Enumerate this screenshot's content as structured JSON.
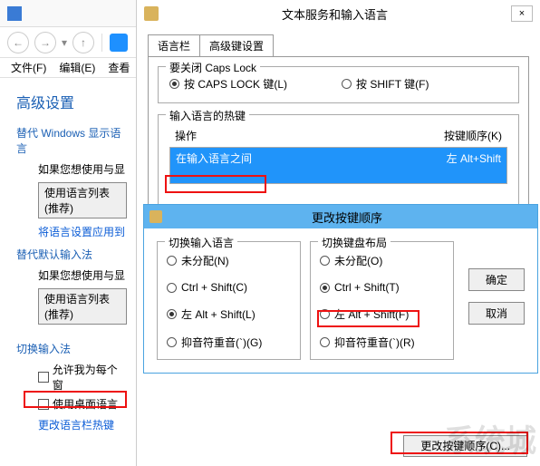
{
  "outer_window": {
    "title": "高级设置",
    "win_min": "—",
    "win_max": "□",
    "win_close": "×",
    "menu": {
      "file": "文件(F)",
      "edit": "编辑(E)",
      "view": "查看"
    }
  },
  "left": {
    "heading": "高级设置",
    "sec1": "替代 Windows 显示语言",
    "sec1_sub": "如果您想使用与显",
    "btn1": "使用语言列表(推荐)",
    "link1": "将语言设置应用到",
    "sec2": "替代默认输入法",
    "sec2_sub": "如果您想使用与显",
    "btn2": "使用语言列表(推荐)",
    "sec3": "切换输入法",
    "chk1": "允许我为每个窗",
    "chk2": "使用桌面语言",
    "link2": "更改语言栏热键"
  },
  "dlg1": {
    "title": "文本服务和输入语言",
    "close": "×",
    "tabs": {
      "t1": "语言栏",
      "t2": "高级键设置"
    },
    "caps_group": "要关闭 Caps Lock",
    "caps_r1": "按 CAPS LOCK 键(L)",
    "caps_r2": "按 SHIFT 键(F)",
    "hot_group": "输入语言的热键",
    "col_op": "操作",
    "col_key": "按键顺序(K)",
    "rows": [
      {
        "op": "在输入语言之间",
        "key": "左 Alt+Shift"
      }
    ],
    "bottom_btn": "更改按键顺序(C)..."
  },
  "dlg2": {
    "title": "更改按键顺序",
    "g1_title": "切换输入语言",
    "g1": {
      "r1": "未分配(N)",
      "r2": "Ctrl + Shift(C)",
      "r3": "左 Alt + Shift(L)",
      "r4": "抑音符重音(`)(G)"
    },
    "g2_title": "切换键盘布局",
    "g2": {
      "r1": "未分配(O)",
      "r2": "Ctrl + Shift(T)",
      "r3": "左 Alt + Shift(F)",
      "r4": "抑音符重音(`)(R)"
    },
    "ok": "确定",
    "cancel": "取消"
  },
  "watermark": "系统城"
}
